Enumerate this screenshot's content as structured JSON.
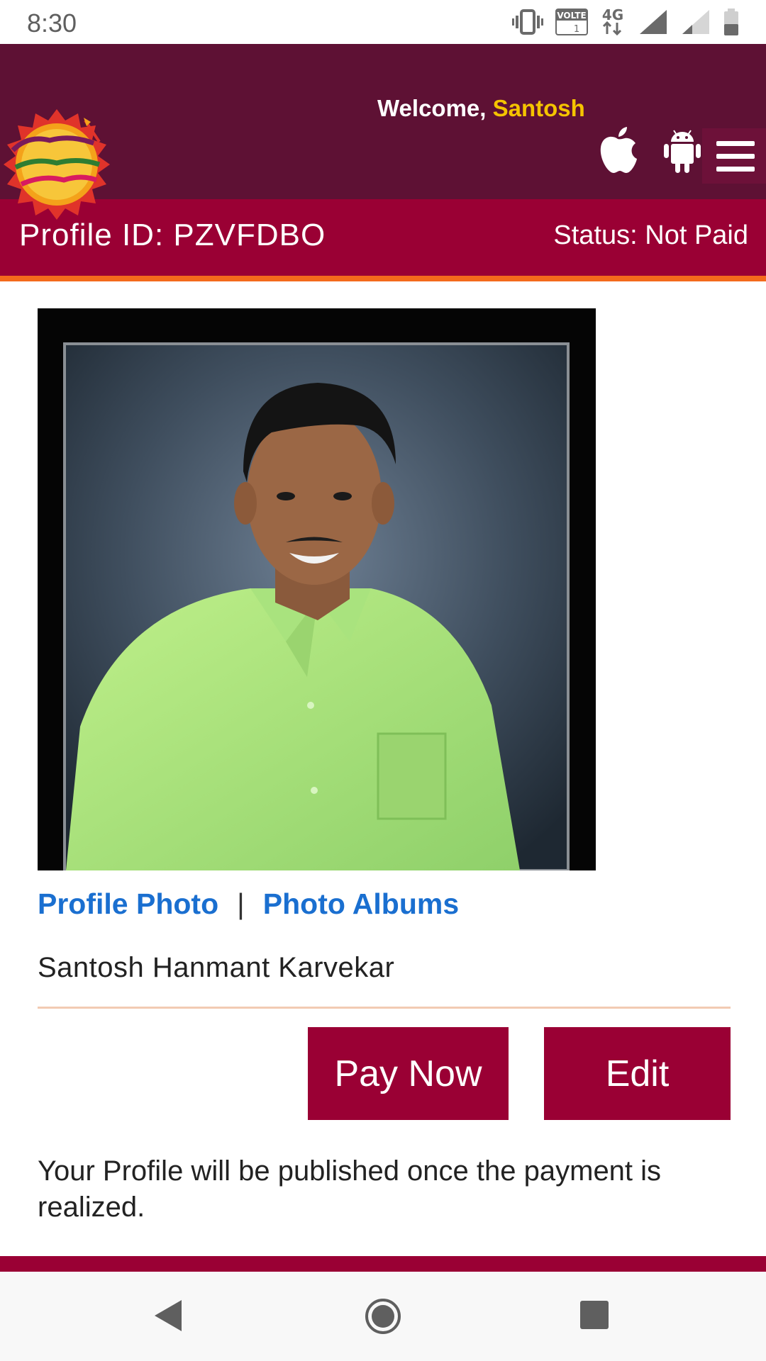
{
  "status_bar": {
    "time": "8:30",
    "icons": [
      "vibrate-icon",
      "volte-icon",
      "4g-data-icon",
      "signal-full-icon",
      "signal-weak-icon",
      "battery-icon"
    ],
    "volte_label": "VOLTE",
    "network_label": "4G"
  },
  "header": {
    "logo_name": "site-logo",
    "welcome_prefix": "Welcome, ",
    "user_name": "Santosh",
    "user_name_color": "#f5c400",
    "background": "#5e1134",
    "icons": [
      "apple-icon",
      "android-icon",
      "hamburger-menu-icon"
    ]
  },
  "profile_bar": {
    "profile_id": "Profile ID: PZVFDBO",
    "status": "Status: Not Paid",
    "background": "#9a0034",
    "accent": "#f46a1c"
  },
  "profile": {
    "photo_links": {
      "profile_photo": "Profile Photo",
      "separator": "|",
      "photo_albums": "Photo Albums"
    },
    "full_name": "Santosh Hanmant Karvekar"
  },
  "actions": {
    "pay_now": "Pay Now",
    "edit": "Edit"
  },
  "notice": "Your Profile will be published once the payment is realized.",
  "nav_bar": {
    "icons": [
      "back-icon",
      "home-icon",
      "recents-icon"
    ]
  }
}
